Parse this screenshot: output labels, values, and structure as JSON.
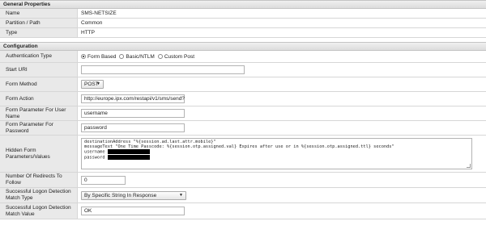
{
  "general": {
    "title": "General Properties",
    "rows": [
      {
        "label": "Name",
        "value": "SMS-NETSIZE"
      },
      {
        "label": "Partition / Path",
        "value": "Common"
      },
      {
        "label": "Type",
        "value": "HTTP"
      }
    ]
  },
  "config": {
    "title": "Configuration",
    "auth_type": {
      "label": "Authentication Type",
      "options": [
        "Form Based",
        "Basic/NTLM",
        "Custom Post"
      ],
      "selected": "Form Based"
    },
    "start_uri": {
      "label": "Start URI",
      "value": ""
    },
    "form_method": {
      "label": "Form Method",
      "value": "POST"
    },
    "form_action": {
      "label": "Form Action",
      "value": "http://europe.ipx.com/restapi/v1/sms/send?"
    },
    "param_user": {
      "label": "Form Parameter For User Name",
      "value": "username"
    },
    "param_pass": {
      "label": "Form Parameter For Password",
      "value": "password"
    },
    "hidden_params": {
      "label": "Hidden Form Parameters/Values",
      "line1": "destinationAddress \"%{session.ad.last.attr.mobile}\"",
      "line2": "messageText \"One Time Passcode: %{session.otp.assigned.val} Expires after use or in %{session.otp.assigned.ttl} seconds\"",
      "line3": "username ",
      "line4": "password "
    },
    "redirects": {
      "label": "Number Of Redirects To Follow",
      "value": "0"
    },
    "detect_type": {
      "label": "Successful Logon Detection Match Type",
      "value": "By Specific String In Response"
    },
    "detect_value": {
      "label": "Successful Logon Detection Match Value",
      "value": "OK"
    }
  }
}
